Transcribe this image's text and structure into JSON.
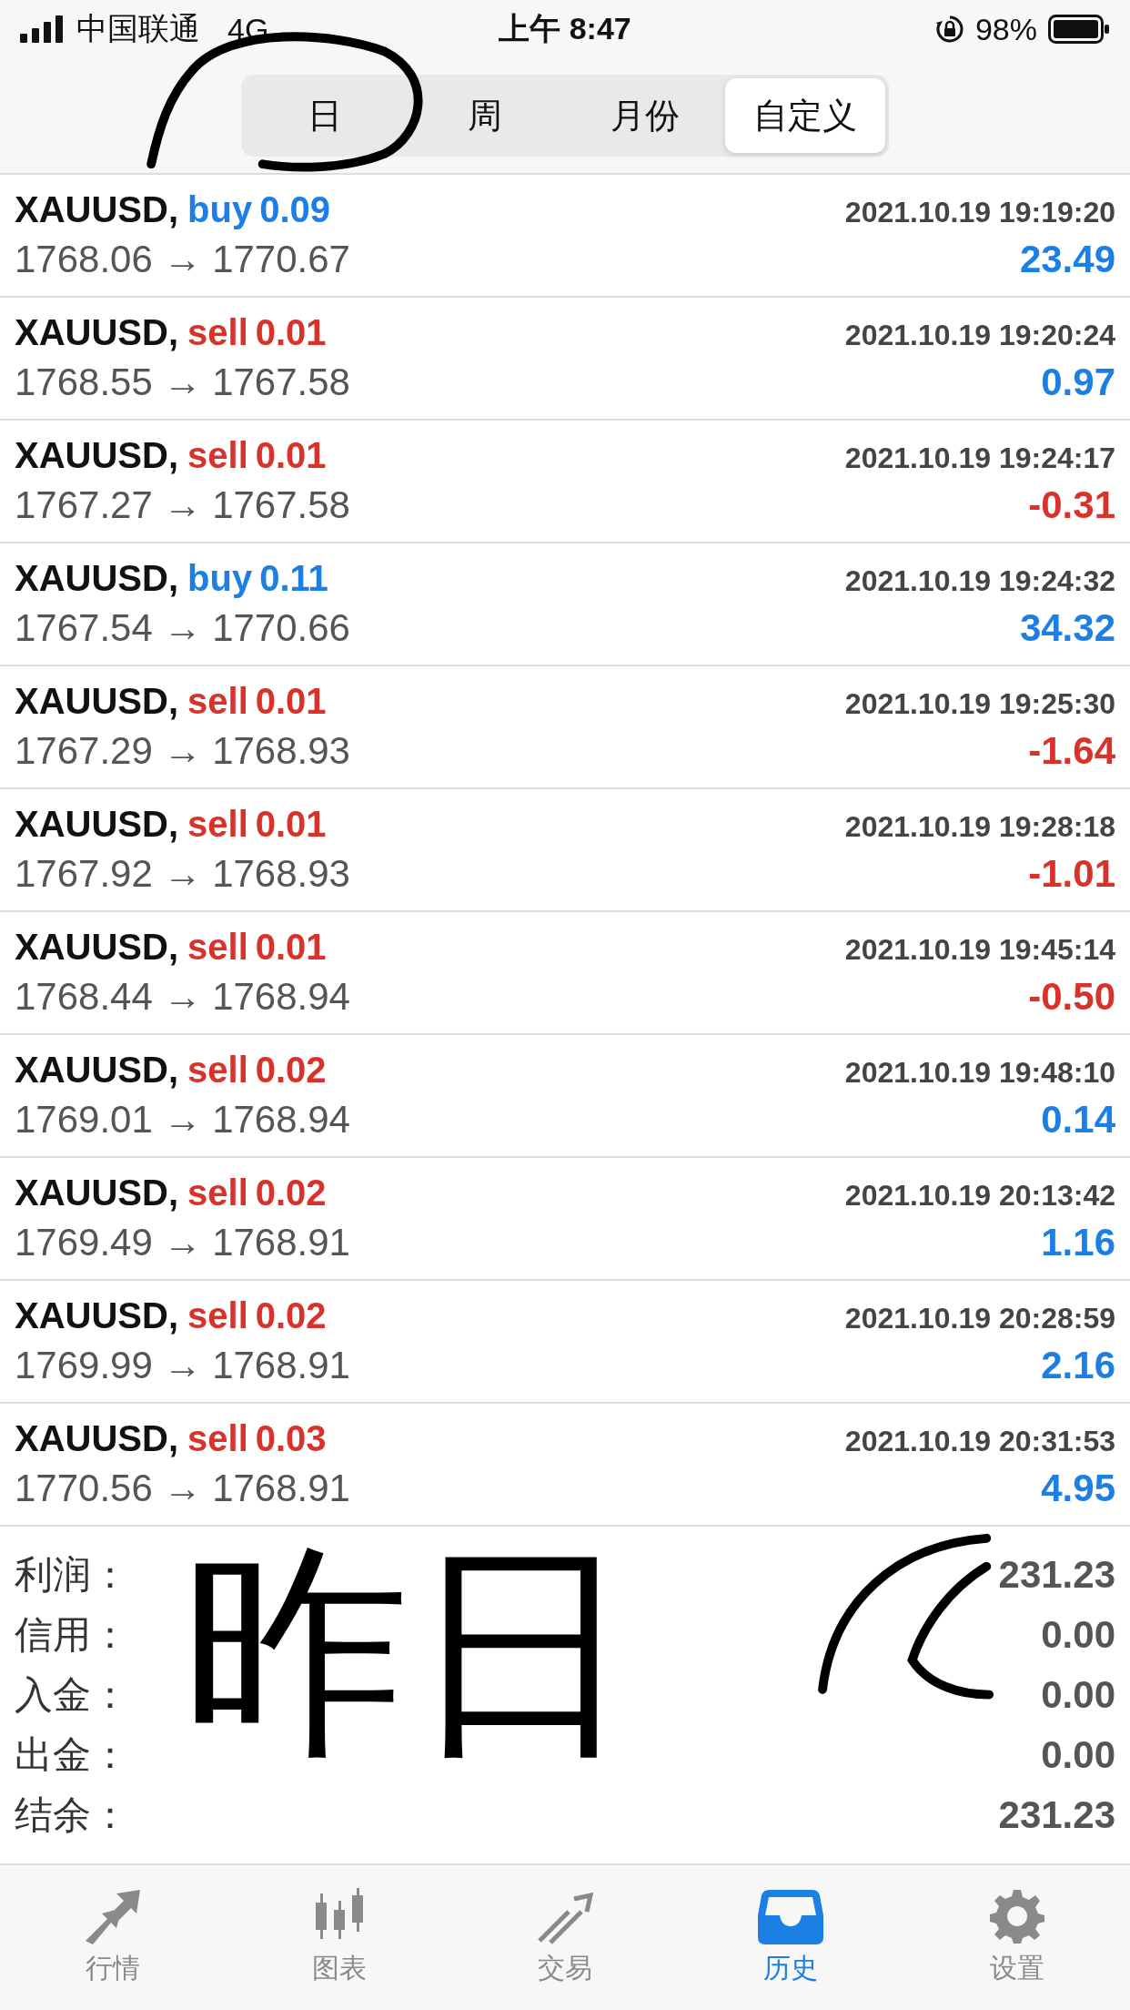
{
  "status_bar": {
    "carrier": "中国联通",
    "network": "4G",
    "time": "上午 8:47",
    "battery": "98%"
  },
  "period_tabs": [
    {
      "label": "日",
      "selected": false
    },
    {
      "label": "周",
      "selected": false
    },
    {
      "label": "月份",
      "selected": false
    },
    {
      "label": "自定义",
      "selected": true
    }
  ],
  "deals": [
    {
      "symbol": "XAUUSD,",
      "side": "buy",
      "volume": "0.09",
      "time": "2021.10.19 19:19:20",
      "prices": "1768.06 → 1770.67",
      "profit": "23.49",
      "loss": false
    },
    {
      "symbol": "XAUUSD,",
      "side": "sell",
      "volume": "0.01",
      "time": "2021.10.19 19:20:24",
      "prices": "1768.55 → 1767.58",
      "profit": "0.97",
      "loss": false
    },
    {
      "symbol": "XAUUSD,",
      "side": "sell",
      "volume": "0.01",
      "time": "2021.10.19 19:24:17",
      "prices": "1767.27 → 1767.58",
      "profit": "-0.31",
      "loss": true
    },
    {
      "symbol": "XAUUSD,",
      "side": "buy",
      "volume": "0.11",
      "time": "2021.10.19 19:24:32",
      "prices": "1767.54 → 1770.66",
      "profit": "34.32",
      "loss": false
    },
    {
      "symbol": "XAUUSD,",
      "side": "sell",
      "volume": "0.01",
      "time": "2021.10.19 19:25:30",
      "prices": "1767.29 → 1768.93",
      "profit": "-1.64",
      "loss": true
    },
    {
      "symbol": "XAUUSD,",
      "side": "sell",
      "volume": "0.01",
      "time": "2021.10.19 19:28:18",
      "prices": "1767.92 → 1768.93",
      "profit": "-1.01",
      "loss": true
    },
    {
      "symbol": "XAUUSD,",
      "side": "sell",
      "volume": "0.01",
      "time": "2021.10.19 19:45:14",
      "prices": "1768.44 → 1768.94",
      "profit": "-0.50",
      "loss": true
    },
    {
      "symbol": "XAUUSD,",
      "side": "sell",
      "volume": "0.02",
      "time": "2021.10.19 19:48:10",
      "prices": "1769.01 → 1768.94",
      "profit": "0.14",
      "loss": false
    },
    {
      "symbol": "XAUUSD,",
      "side": "sell",
      "volume": "0.02",
      "time": "2021.10.19 20:13:42",
      "prices": "1769.49 → 1768.91",
      "profit": "1.16",
      "loss": false
    },
    {
      "symbol": "XAUUSD,",
      "side": "sell",
      "volume": "0.02",
      "time": "2021.10.19 20:28:59",
      "prices": "1769.99 → 1768.91",
      "profit": "2.16",
      "loss": false
    },
    {
      "symbol": "XAUUSD,",
      "side": "sell",
      "volume": "0.03",
      "time": "2021.10.19 20:31:53",
      "prices": "1770.56 → 1768.91",
      "profit": "4.95",
      "loss": false
    }
  ],
  "summary": [
    {
      "label": "利润：",
      "value": "231.23"
    },
    {
      "label": "信用：",
      "value": "0.00"
    },
    {
      "label": "入金：",
      "value": "0.00"
    },
    {
      "label": "出金：",
      "value": "0.00"
    },
    {
      "label": "结余：",
      "value": "231.23"
    }
  ],
  "annotation": {
    "text": "昨日"
  },
  "bottom_nav": [
    {
      "label": "行情",
      "selected": false
    },
    {
      "label": "图表",
      "selected": false
    },
    {
      "label": "交易",
      "selected": false
    },
    {
      "label": "历史",
      "selected": true
    },
    {
      "label": "设置",
      "selected": false
    }
  ]
}
